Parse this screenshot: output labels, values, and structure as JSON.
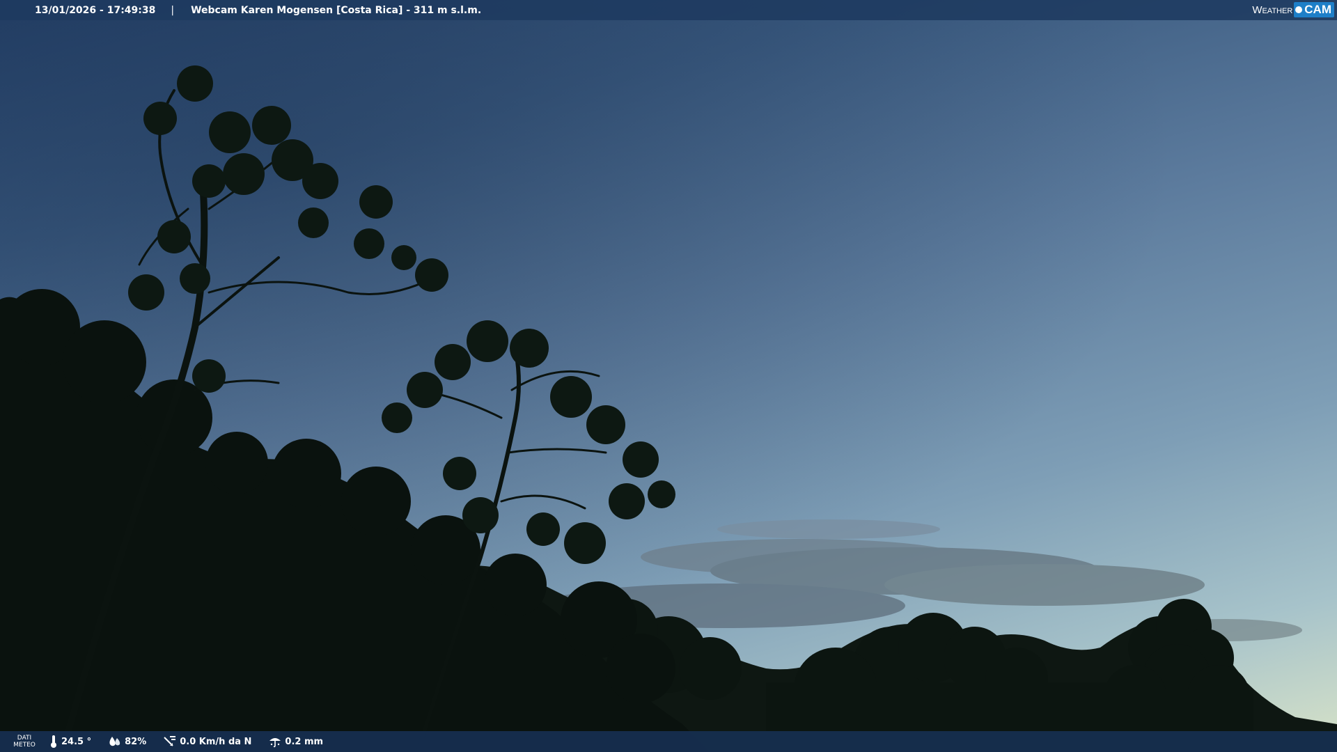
{
  "header": {
    "datetime": "13/01/2026 - 17:49:38",
    "separator": "|",
    "title": "Webcam Karen Mogensen [Costa Rica] - 311 m s.l.m.",
    "logo_weather": "Weather",
    "logo_cam": "CAM"
  },
  "footer": {
    "meteo_line1": "DATI",
    "meteo_line2": "METEO",
    "temperature": "24.5 °",
    "humidity": "82%",
    "wind": "0.0 Km/h da N",
    "rain": "0.2 mm"
  },
  "colors": {
    "bar": "#1e3a60",
    "logo_accent": "#1e7fc8",
    "sky_top": "#25426a",
    "sky_horizon": "#d8e3c8",
    "foliage": "#0d1410"
  },
  "icons": [
    "thermometer-icon",
    "humidity-icon",
    "wind-icon",
    "rain-icon"
  ]
}
